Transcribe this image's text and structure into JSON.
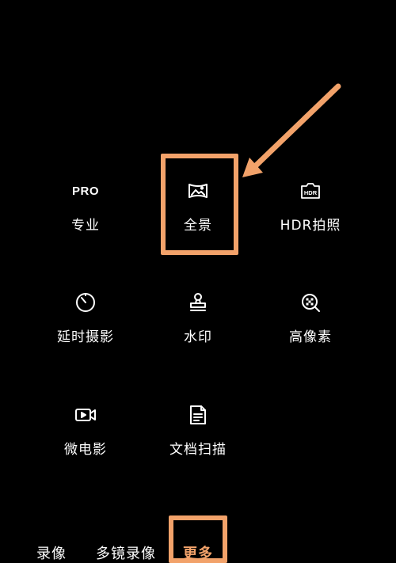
{
  "modes": {
    "pro": {
      "icon_text": "PRO",
      "label": "专业",
      "icon": "pro-icon"
    },
    "panorama": {
      "label": "全景",
      "icon": "panorama-icon"
    },
    "hdr": {
      "icon_text": "HDR",
      "label": "HDR拍照",
      "icon": "hdr-icon"
    },
    "timelapse": {
      "label": "延时摄影",
      "icon": "timer-icon"
    },
    "watermark": {
      "label": "水印",
      "icon": "stamp-icon"
    },
    "high_res": {
      "label": "高像素",
      "icon": "high-res-icon"
    },
    "micro_movie": {
      "label": "微电影",
      "icon": "video-camera-icon"
    },
    "doc_scan": {
      "label": "文档扫描",
      "icon": "document-icon"
    }
  },
  "bottom_tabs": [
    {
      "label": "录像"
    },
    {
      "label": "多镜录像"
    },
    {
      "label": "更多",
      "active": true
    }
  ],
  "colors": {
    "background": "#000000",
    "text": "#ffffff",
    "highlight": "#f2a26a"
  }
}
